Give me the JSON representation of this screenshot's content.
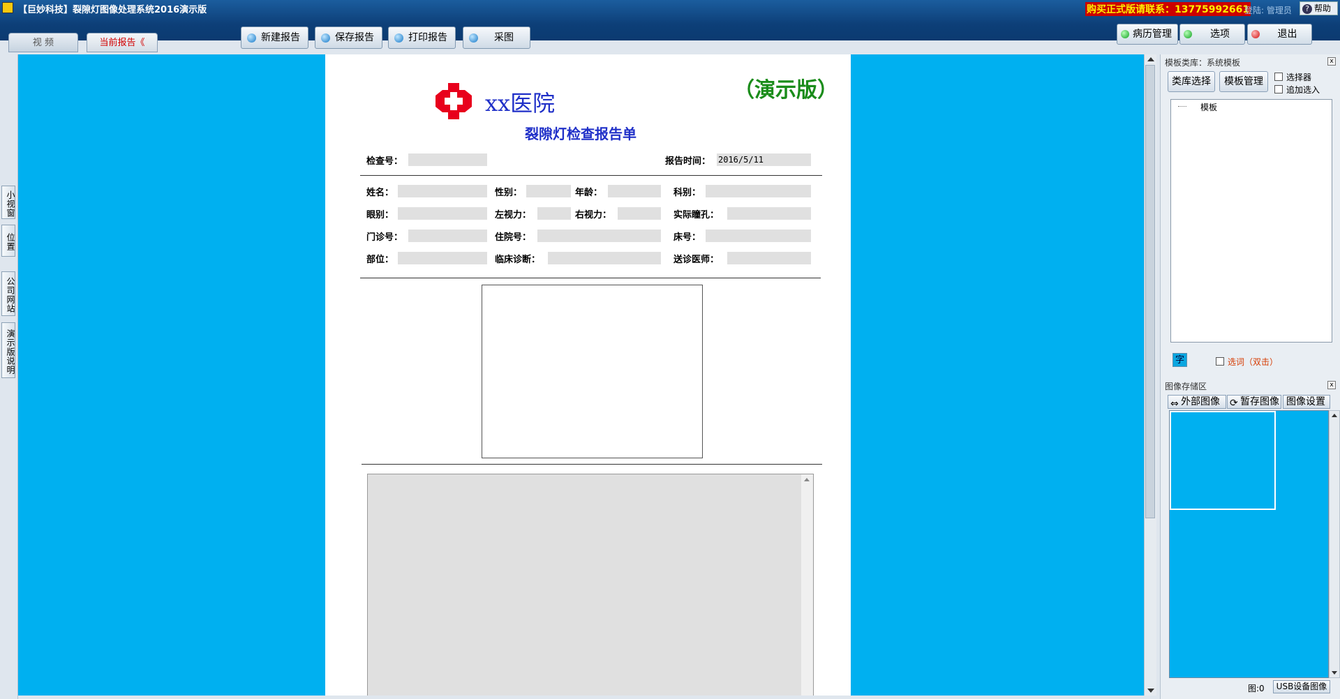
{
  "window": {
    "title": "【巨妙科技】裂隙灯图像处理系统2016演示版",
    "buy_contact": "购买正式版请联系：13775992661",
    "login_info": "登陆: 管理员",
    "help_label": "帮助"
  },
  "tabs": {
    "video": "视 频",
    "current_report": "当前报告《"
  },
  "toolbar": {
    "new_report": "新建报告",
    "save_report": "保存报告",
    "print_report": "打印报告",
    "capture": "采图"
  },
  "right_toolbar": {
    "records": "病历管理",
    "options": "选项",
    "exit": "退出"
  },
  "left_tabs": [
    "小视窗",
    "位置",
    "公司网站",
    "演示版说明"
  ],
  "report": {
    "hospital": "xx医院",
    "demo_tag": "（演示版）",
    "title": "裂隙灯检查报告单",
    "exam_no_label": "检查号：",
    "report_time_label": "报告时间：",
    "report_time_value": "2016/5/11",
    "name_label": "姓名：",
    "gender_label": "性别：",
    "age_label": "年龄：",
    "dept_label": "科别：",
    "eye_label": "眼别：",
    "left_vision_label": "左视力：",
    "right_vision_label": "右视力：",
    "pupil_label": "实际瞳孔：",
    "outpatient_label": "门诊号：",
    "inpatient_label": "住院号：",
    "bed_label": "床号：",
    "part_label": "部位：",
    "diagnosis_label": "临床诊断：",
    "doctor_label": "送诊医师："
  },
  "template_panel": {
    "header": "模板类库：系统模板",
    "library_select": "类库选择",
    "template_manage": "模板管理",
    "selector_label": "选择器",
    "append_label": "追加选入",
    "tree_item": "模板",
    "zi_label": "字",
    "select_word_label": "选词（双击）"
  },
  "image_panel": {
    "header": "图像存储区",
    "external_image": "外部图像",
    "temp_image": "暂存图像",
    "image_settings": "图像设置",
    "count": "图:0",
    "usb_device_image": "USB设备图像"
  },
  "colors": {
    "accent": "#00b0f0",
    "title_blue": "#2030c8",
    "demo_green": "#1a8c1a",
    "cross_red": "#e8001c"
  }
}
